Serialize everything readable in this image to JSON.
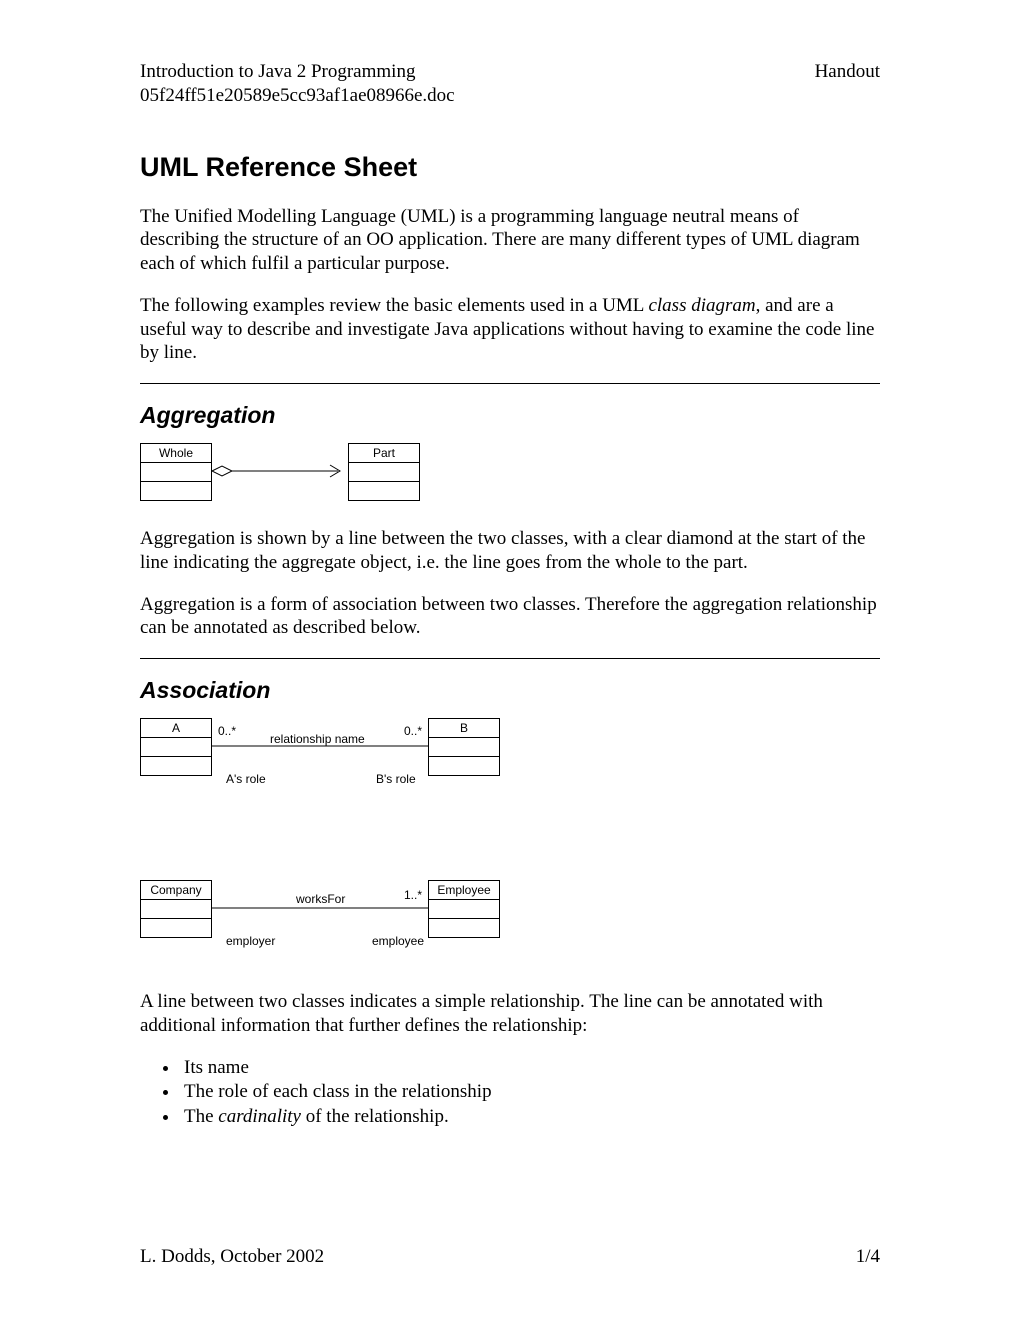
{
  "header": {
    "left_line1": "Introduction to Java 2 Programming",
    "left_line2": "05f24ff51e20589e5cc93af1ae08966e.doc",
    "right": "Handout"
  },
  "title": "UML Reference Sheet",
  "intro_p1": "The Unified Modelling Language (UML) is a programming language neutral means of describing the structure of an OO application. There are many different types of UML diagram each of which fulfil a particular purpose.",
  "intro_p2_a": "The following examples review the basic elements used in a UML ",
  "intro_p2_em": "class diagram",
  "intro_p2_b": ", and are a useful way to describe and investigate Java applications without having to examine the code line by line.",
  "aggregation": {
    "heading": "Aggregation",
    "whole": "Whole",
    "part": "Part",
    "p1": "Aggregation is shown by a line between the two classes, with a clear diamond at the start of the line indicating the aggregate object, i.e. the line goes from the whole to the part.",
    "p2": "Aggregation is a form of association between two classes. Therefore the aggregation relationship can be annotated as described below."
  },
  "association": {
    "heading": "Association",
    "classA": "A",
    "classB": "B",
    "multA": "0..*",
    "multB": "0..*",
    "relName": "relationship name",
    "roleA": "A's role",
    "roleB": "B's role",
    "company": "Company",
    "employee": "Employee",
    "worksFor": "worksFor",
    "multEmp": "1..*",
    "roleEmployer": "employer",
    "roleEmployee": "employee",
    "p1": "A line between two classes indicates a simple relationship. The line can be annotated with additional information that further defines the relationship:",
    "b1": "Its name",
    "b2": "The role of each class in the relationship",
    "b3_a": "The ",
    "b3_em": "cardinality",
    "b3_b": " of the relationship."
  },
  "footer": {
    "left": "L. Dodds, October 2002",
    "right": "1/4"
  }
}
